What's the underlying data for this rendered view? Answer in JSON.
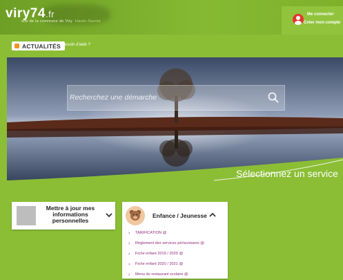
{
  "header": {
    "logo": {
      "name": "viry74",
      "tld": ".fr",
      "subtitle": "site de la commune de Viry",
      "subtitle_suffix": "Haute-Savoie"
    },
    "account": {
      "login_label": "Me connecter",
      "create_label": "Créer mon compte",
      "avatar_icon": "user-avatar-icon",
      "avatar_color": "#e3362d"
    }
  },
  "subnav": {
    "news_label": "ACTUALITÉS",
    "news_icon": "rss-icon",
    "help_label": "Besoin d'aide ?"
  },
  "hero": {
    "search_placeholder": "Recherchez une démarche",
    "search_icon": "search-icon",
    "tagline": "Sélectionnez un service"
  },
  "cards": {
    "profile": {
      "title": "Mettre à jour mes informations personnelles",
      "chevron_icon": "chevron-down-icon"
    },
    "enfance": {
      "title": "Enfance / Jeunesse",
      "icon": "teddy-bear-icon",
      "chevron_icon": "chevron-up-icon",
      "items": [
        "TARIFICATION @",
        "Règlement des services périscolaires @",
        "Fiche enfant 2019 / 2020 @",
        "Fiche enfant 2020 / 2021 @",
        "Menu du restaurant scolaire @"
      ]
    }
  },
  "colors": {
    "brand_green": "#8bbe35",
    "link_purple": "#8e2b7a",
    "rss_orange": "#f29322"
  }
}
